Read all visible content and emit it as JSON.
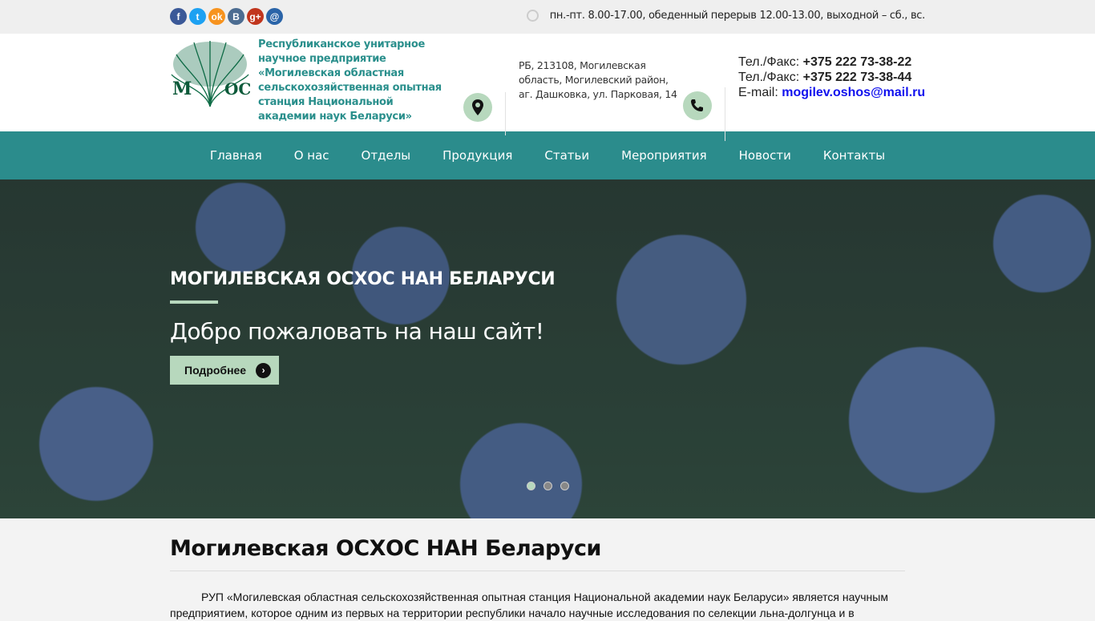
{
  "topbar": {
    "social": [
      {
        "name": "facebook",
        "glyph": "f",
        "color": "#3b5998"
      },
      {
        "name": "twitter",
        "glyph": "t",
        "color": "#1da1f2"
      },
      {
        "name": "odnoklassniki",
        "glyph": "ok",
        "color": "#f7931e"
      },
      {
        "name": "vkontakte",
        "glyph": "B",
        "color": "#4c6c91"
      },
      {
        "name": "google-plus",
        "glyph": "g+",
        "color": "#c1351d"
      },
      {
        "name": "email",
        "glyph": "@",
        "color": "#2a64a8"
      }
    ],
    "hours": "пн.-пт. 8.00-17.00, обеденный перерыв 12.00-13.00, выходной – сб., вс."
  },
  "header": {
    "logo_text": "МОС",
    "org_name": "Республиканское унитарное научное предприятие «Могилевская областная сельскохозяйственная опытная станция Национальной академии наук Беларуси»",
    "address": "РБ, 213108, Могилевская область, Могилевский район, аг. Дашковка, ул. Парковая, 14",
    "phone1_label": "Тел./Факс: ",
    "phone1": "+375 222 73-38-22",
    "phone2_label": "Тел./Факс: ",
    "phone2": "+375 222 73-38-44",
    "email_label": "E-mail: ",
    "email": "mogilev.oshos@mail.ru"
  },
  "nav": [
    "Главная",
    "О нас",
    "Отделы",
    "Продукция",
    "Статьи",
    "Мероприятия",
    "Новости",
    "Контакты"
  ],
  "slider": {
    "title": "МОГИЛЕВСКАЯ ОСХОС НАН БЕЛАРУСИ",
    "subtitle": "Добро пожаловать на наш сайт!",
    "button": "Подробнее",
    "slides": 3,
    "active": 1
  },
  "main": {
    "title": "Могилевская ОСХОС НАН Беларуси",
    "text": "РУП «Могилевская областная сельскохозяйственная опытная станция Национальной академии наук Беларуси» является научным предприятием, которое одним из первых на территории республики начало научные исследования по селекции льна-долгунца и в"
  }
}
